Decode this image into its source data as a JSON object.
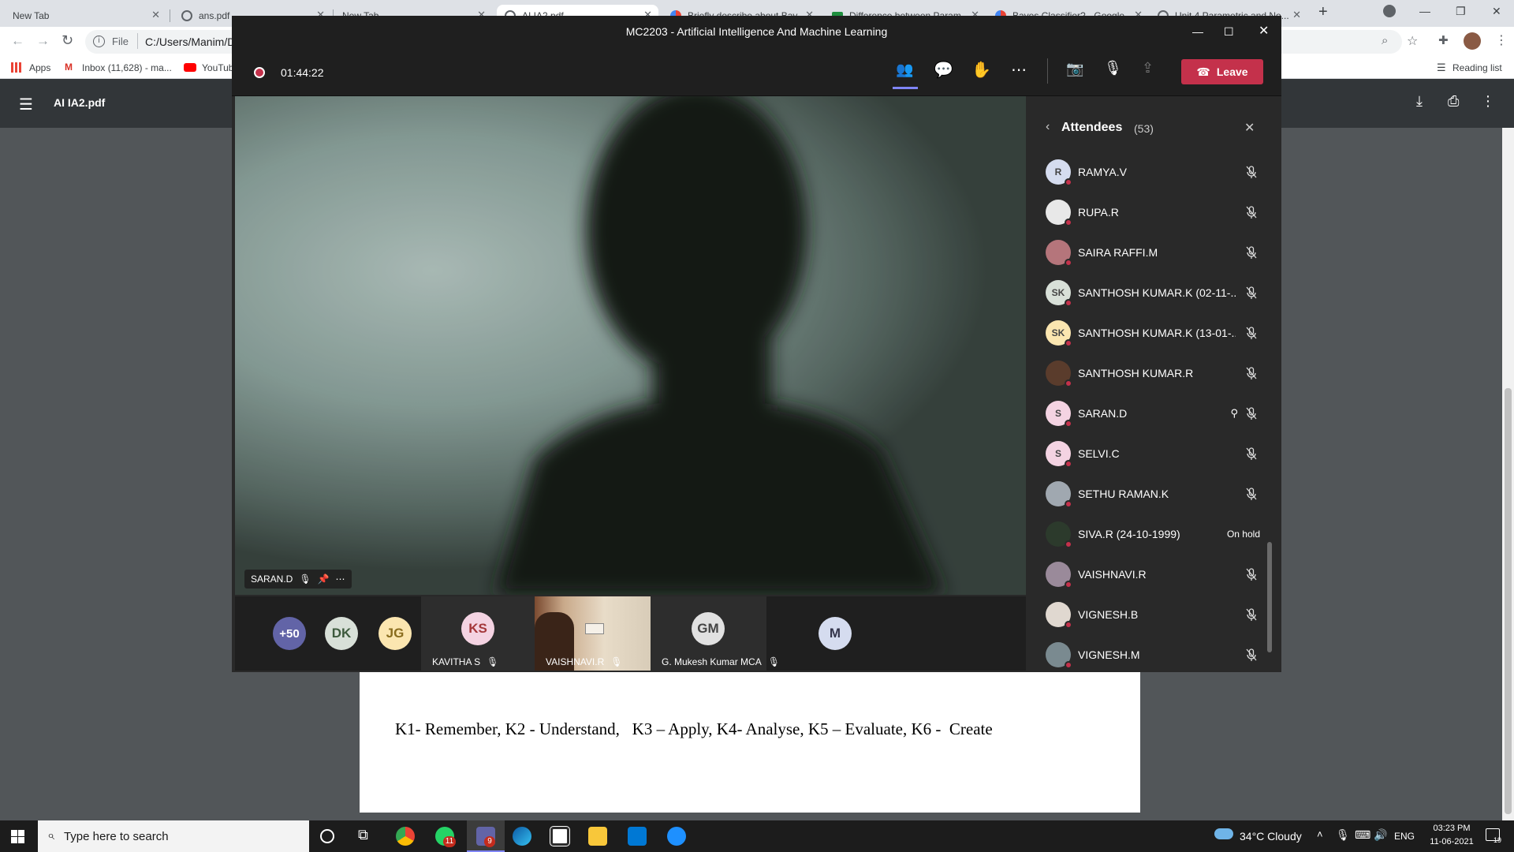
{
  "browser": {
    "tabs": [
      {
        "title": "New Tab"
      },
      {
        "title": "ans.pdf"
      },
      {
        "title": "New Tab"
      },
      {
        "title": "AI IA2.pdf"
      },
      {
        "title": "Briefly describe about Bay..."
      },
      {
        "title": "Difference between Param..."
      },
      {
        "title": "Bayes Classifier? - Google..."
      },
      {
        "title": "Unit 4 Parametric and No..."
      }
    ],
    "new_tab_label": "+",
    "address_prefix": "File",
    "address": "C:/Users/Manim/D",
    "bookmarks": [
      "Apps",
      "Inbox (11,628) - ma...",
      "YouTub"
    ],
    "reading_list_label": "Reading list"
  },
  "pdf": {
    "file_name": "AI IA2.pdf",
    "page_text": "K1- Remember, K2 - Understand,   K3 – Apply, K4- Analyse, K5 – Evaluate, K6 -  Create"
  },
  "teams": {
    "window_title": "MC2203 - Artificial Intelligence And Machine Learning",
    "meeting_timer": "01:44:22",
    "leave_label": "Leave",
    "main_video_name": "SARAN.D",
    "strip": {
      "overflow_count": "+50",
      "avatars": [
        "DK",
        "JG"
      ],
      "tiles": [
        {
          "initials": "KS",
          "name": "KAVITHA S",
          "color": "#f4d3e2",
          "text_color": "#a4373a"
        },
        {
          "initials": "",
          "name": "VAISHNAVI.R",
          "color": "#c9a98a",
          "text_color": "#000"
        },
        {
          "initials": "GM",
          "name": "G. Mukesh Kumar MCA",
          "color": "#e1e1e1",
          "text_color": "#444"
        },
        {
          "initials": "M",
          "name": "",
          "color": "#d5dcef",
          "text_color": "#33344a"
        }
      ]
    },
    "attendees_panel": {
      "title": "Attendees",
      "count": "(53)",
      "list": [
        {
          "initials": "R",
          "name": "RAMYA.V",
          "avatar_color": "#d5dcef",
          "status": "muted"
        },
        {
          "initials": "",
          "name": "RUPA.R",
          "avatar_color": "#e8e8e8",
          "status": "muted"
        },
        {
          "initials": "",
          "name": "SAIRA RAFFI.M",
          "avatar_color": "#b5757b",
          "status": "muted"
        },
        {
          "initials": "SK",
          "name": "SANTHOSH KUMAR.K (02-11-...",
          "avatar_color": "#d8e0d8",
          "status": "muted"
        },
        {
          "initials": "SK",
          "name": "SANTHOSH KUMAR.K (13-01-...",
          "avatar_color": "#fbe6b0",
          "status": "muted"
        },
        {
          "initials": "",
          "name": "SANTHOSH KUMAR.R",
          "avatar_color": "#5a3c2c",
          "status": "muted"
        },
        {
          "initials": "S",
          "name": "SARAN.D",
          "avatar_color": "#f4d3e2",
          "status": "pinned"
        },
        {
          "initials": "S",
          "name": "SELVI.C",
          "avatar_color": "#f4d3e2",
          "status": "muted"
        },
        {
          "initials": "",
          "name": "SETHU RAMAN.K",
          "avatar_color": "#a0a8b0",
          "status": "muted"
        },
        {
          "initials": "",
          "name": "SIVA.R (24-10-1999)",
          "avatar_color": "#2c3a2c",
          "status": "On hold"
        },
        {
          "initials": "",
          "name": "VAISHNAVI.R",
          "avatar_color": "#9a8a9a",
          "status": "muted"
        },
        {
          "initials": "",
          "name": "VIGNESH.B",
          "avatar_color": "#e0d8d0",
          "status": "muted"
        },
        {
          "initials": "",
          "name": "VIGNESH.M",
          "avatar_color": "#7a8a90",
          "status": "muted"
        }
      ]
    }
  },
  "taskbar": {
    "search_placeholder": "Type here to search",
    "weather": "34°C  Cloudy",
    "language": "ENG",
    "time": "03:23 PM",
    "date": "11-06-2021",
    "teams_badge": "9",
    "whatsapp_badge": "11",
    "notification_count": "19"
  },
  "colors": {
    "leave_red": "#c4314b",
    "teams_purple": "#6264a7",
    "record_red": "#c4314b"
  }
}
